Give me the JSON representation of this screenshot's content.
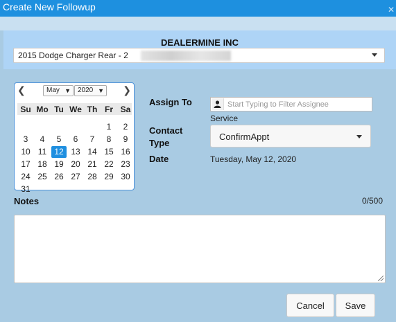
{
  "window": {
    "title": "Create New Followup",
    "close_icon": "close-icon"
  },
  "header": {
    "dealer_name": "DEALERMINE INC",
    "vehicle_select": {
      "value": "2015 Dodge Charger Rear - 2"
    }
  },
  "calendar": {
    "month": "May",
    "year": "2020",
    "weekdays": [
      "Su",
      "Mo",
      "Tu",
      "We",
      "Th",
      "Fr",
      "Sa"
    ],
    "weeks": [
      [
        "",
        "",
        "",
        "",
        "",
        "1",
        "2"
      ],
      [
        "3",
        "4",
        "5",
        "6",
        "7",
        "8",
        "9"
      ],
      [
        "10",
        "11",
        "12",
        "13",
        "14",
        "15",
        "16"
      ],
      [
        "17",
        "18",
        "19",
        "20",
        "21",
        "22",
        "23"
      ],
      [
        "24",
        "25",
        "26",
        "27",
        "28",
        "29",
        "30"
      ],
      [
        "31",
        "",
        "",
        "",
        "",
        "",
        ""
      ]
    ],
    "selected_day": "12",
    "selected_color": "#1e8fe0"
  },
  "form": {
    "assign_to_label": "Assign To",
    "assignee_placeholder": "Start Typing to Filter Assignee",
    "assignee_value": "Service",
    "contact_type_label_1": "Contact",
    "contact_type_label_2": "Type",
    "contact_type_value": "ConfirmAppt",
    "date_label": "Date",
    "date_value": "Tuesday, May 12, 2020"
  },
  "notes": {
    "label": "Notes",
    "counter": "0/500"
  },
  "buttons": {
    "cancel": "Cancel",
    "save": "Save"
  },
  "colors": {
    "titlebar": "#1e90df",
    "dialog_bg": "#a9cbe3",
    "header_bg": "#aed4f6"
  }
}
